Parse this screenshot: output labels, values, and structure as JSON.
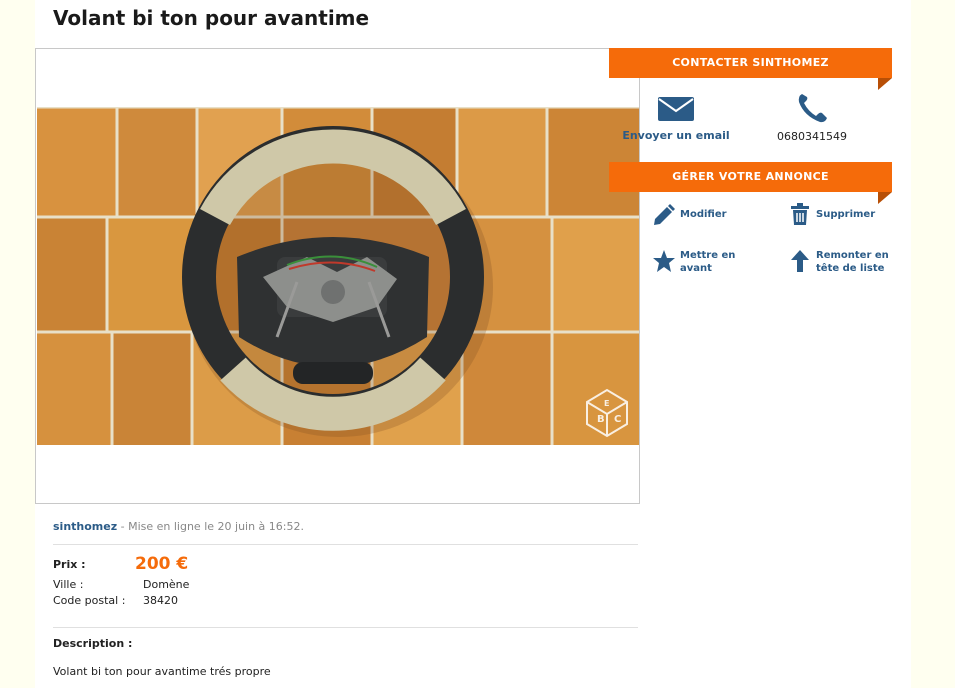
{
  "listing": {
    "title": "Volant bi ton pour avantime",
    "user": "sinthomez",
    "posted": " - Mise en ligne le 20 juin à 16:52.",
    "price_label": "Prix :",
    "price": "200 €",
    "city_label": "Ville :",
    "city": "Domène",
    "postal_label": "Code postal :",
    "postal": "38420",
    "description_label": "Description :",
    "description": "Volant bi ton pour avantime trés propre",
    "watermark_letters": "BCE"
  },
  "contact": {
    "header": "CONTACTER SINTHOMEZ",
    "email_label": "Envoyer un email",
    "email_icon": "envelope-icon",
    "phone": "0680341549",
    "phone_icon": "phone-icon"
  },
  "manage": {
    "header": "GÉRER VOTRE ANNONCE",
    "edit": "Modifier",
    "delete": "Supprimer",
    "feature_line1": "Mettre en",
    "feature_line2": "avant",
    "bump_line1": "Remonter en",
    "bump_line2": "tête de liste"
  },
  "colors": {
    "accent": "#f56b0a",
    "link": "#2b5b87",
    "background": "#fffff0"
  }
}
